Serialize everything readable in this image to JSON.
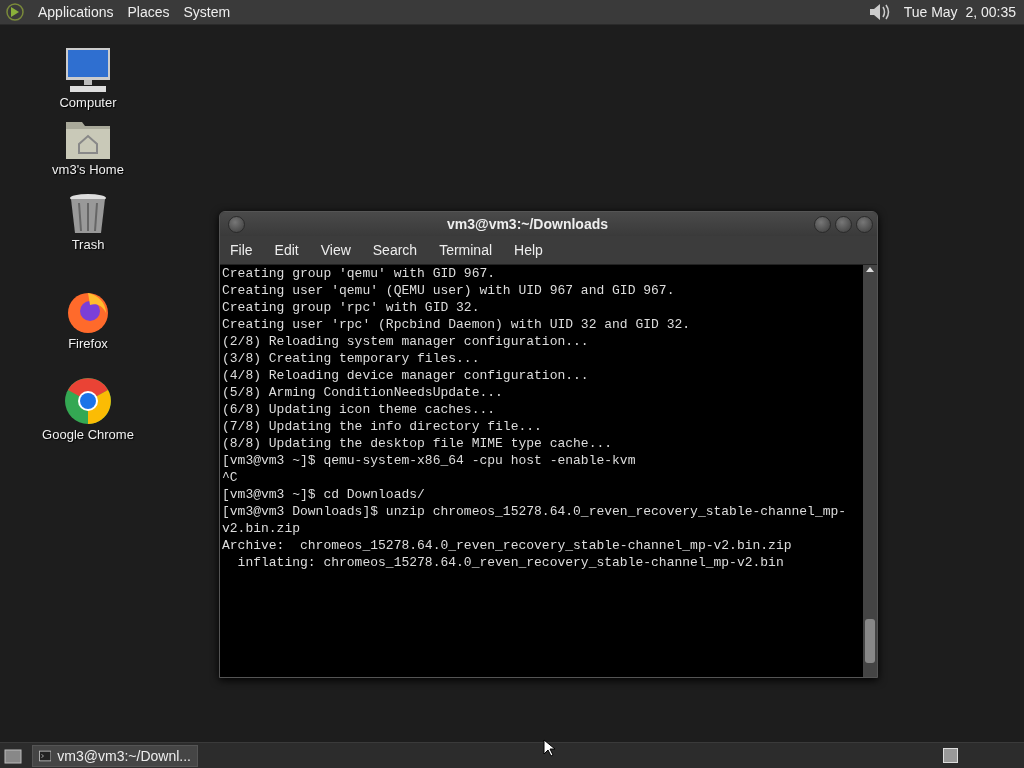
{
  "top_panel": {
    "menus": [
      "Applications",
      "Places",
      "System"
    ],
    "clock": "Tue May  2, 00:35"
  },
  "desktop_icons": [
    {
      "kind": "computer",
      "label": "Computer"
    },
    {
      "kind": "home",
      "label": "vm3's Home"
    },
    {
      "kind": "trash",
      "label": "Trash"
    },
    {
      "kind": "firefox",
      "label": "Firefox"
    },
    {
      "kind": "chrome",
      "label": "Google Chrome"
    }
  ],
  "window": {
    "title": "vm3@vm3:~/Downloads",
    "menu": [
      "File",
      "Edit",
      "View",
      "Search",
      "Terminal",
      "Help"
    ],
    "lines": [
      "Creating group 'qemu' with GID 967.",
      "Creating user 'qemu' (QEMU user) with UID 967 and GID 967.",
      "Creating group 'rpc' with GID 32.",
      "Creating user 'rpc' (Rpcbind Daemon) with UID 32 and GID 32.",
      "(2/8) Reloading system manager configuration...",
      "(3/8) Creating temporary files...",
      "(4/8) Reloading device manager configuration...",
      "(5/8) Arming ConditionNeedsUpdate...",
      "(6/8) Updating icon theme caches...",
      "(7/8) Updating the info directory file...",
      "(8/8) Updating the desktop file MIME type cache...",
      "[vm3@vm3 ~]$ qemu-system-x86_64 -cpu host -enable-kvm",
      "^C",
      "[vm3@vm3 ~]$ cd Downloads/",
      "[vm3@vm3 Downloads]$ unzip chromeos_15278.64.0_reven_recovery_stable-channel_mp-",
      "v2.bin.zip",
      "Archive:  chromeos_15278.64.0_reven_recovery_stable-channel_mp-v2.bin.zip",
      "  inflating: chromeos_15278.64.0_reven_recovery_stable-channel_mp-v2.bin"
    ]
  },
  "taskbar": {
    "items": [
      {
        "label": "vm3@vm3:~/Downl...",
        "selected": false
      }
    ]
  }
}
